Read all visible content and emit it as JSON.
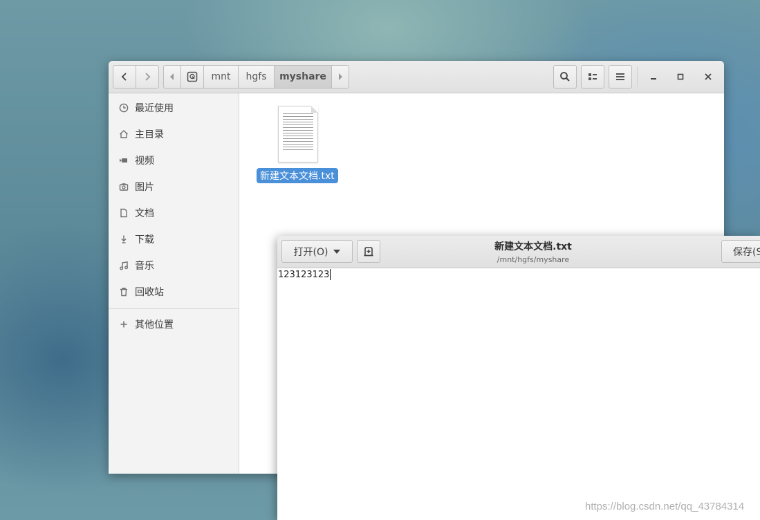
{
  "file_manager": {
    "path_segments": [
      "mnt",
      "hgfs",
      "myshare"
    ],
    "sidebar": {
      "items": [
        {
          "label": "最近使用",
          "icon": "clock-icon"
        },
        {
          "label": "主目录",
          "icon": "home-icon"
        },
        {
          "label": "视频",
          "icon": "video-icon"
        },
        {
          "label": "图片",
          "icon": "camera-icon"
        },
        {
          "label": "文档",
          "icon": "document-icon"
        },
        {
          "label": "下载",
          "icon": "download-icon"
        },
        {
          "label": "音乐",
          "icon": "music-icon"
        },
        {
          "label": "回收站",
          "icon": "trash-icon"
        }
      ],
      "other_locations": {
        "label": "其他位置",
        "icon": "plus-icon"
      }
    },
    "files": [
      {
        "name": "新建文本文档.txt",
        "selected": true,
        "icon": "text-file-icon"
      }
    ],
    "accent_color": "#4a90d9"
  },
  "editor": {
    "open_label": "打开(O)",
    "title": "新建文本文档.txt",
    "subtitle": "/mnt/hgfs/myshare",
    "save_label": "保存(S",
    "content": "123123123"
  },
  "watermark": "https://blog.csdn.net/qq_43784314"
}
